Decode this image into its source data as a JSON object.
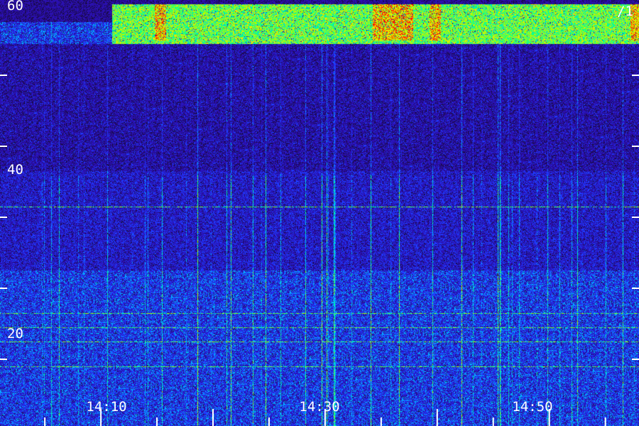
{
  "chart_data": {
    "type": "heatmap",
    "title": "",
    "xlabel": "",
    "ylabel": "",
    "ylim": [
      0,
      60
    ],
    "y_tick_labels": [
      "20",
      "40",
      "60"
    ],
    "x_tick_labels": [
      "14:10",
      "14:30",
      "14:50"
    ],
    "x_label_times_min": [
      850,
      870,
      890
    ],
    "time_range_min": [
      841,
      898
    ],
    "corner_label": "/1",
    "colormap": [
      "#1a0a4a",
      "#2a10b0",
      "#1f3cff",
      "#00b8ff",
      "#00ff9c",
      "#a8ff00",
      "#ffe000",
      "#ff1000"
    ],
    "bands": [
      {
        "y_low": 54.5,
        "y_high": 60,
        "intensity": "high",
        "t_start": 851,
        "t_end": 898
      },
      {
        "y_low": 54.5,
        "y_high": 57.5,
        "intensity": "medium",
        "t_start": 841,
        "t_end": 851
      },
      {
        "y_low": 36.5,
        "y_high": 54.5,
        "intensity": "low"
      },
      {
        "y_low": 22.5,
        "y_high": 36.5,
        "intensity": "low-medium",
        "note": "streaks"
      },
      {
        "y_low": 0,
        "y_high": 22.5,
        "intensity": "medium",
        "note": "horizontal lines"
      }
    ],
    "hot_regions": [
      {
        "t_start": 854.8,
        "t_end": 855.8,
        "y_low": 55,
        "y_high": 60
      },
      {
        "t_start": 874.2,
        "t_end": 877.8,
        "y_low": 55,
        "y_high": 60
      },
      {
        "t_start": 879.3,
        "t_end": 880.3,
        "y_low": 55,
        "y_high": 60
      },
      {
        "t_start": 897.2,
        "t_end": 898,
        "y_low": 55,
        "y_high": 60
      }
    ]
  }
}
